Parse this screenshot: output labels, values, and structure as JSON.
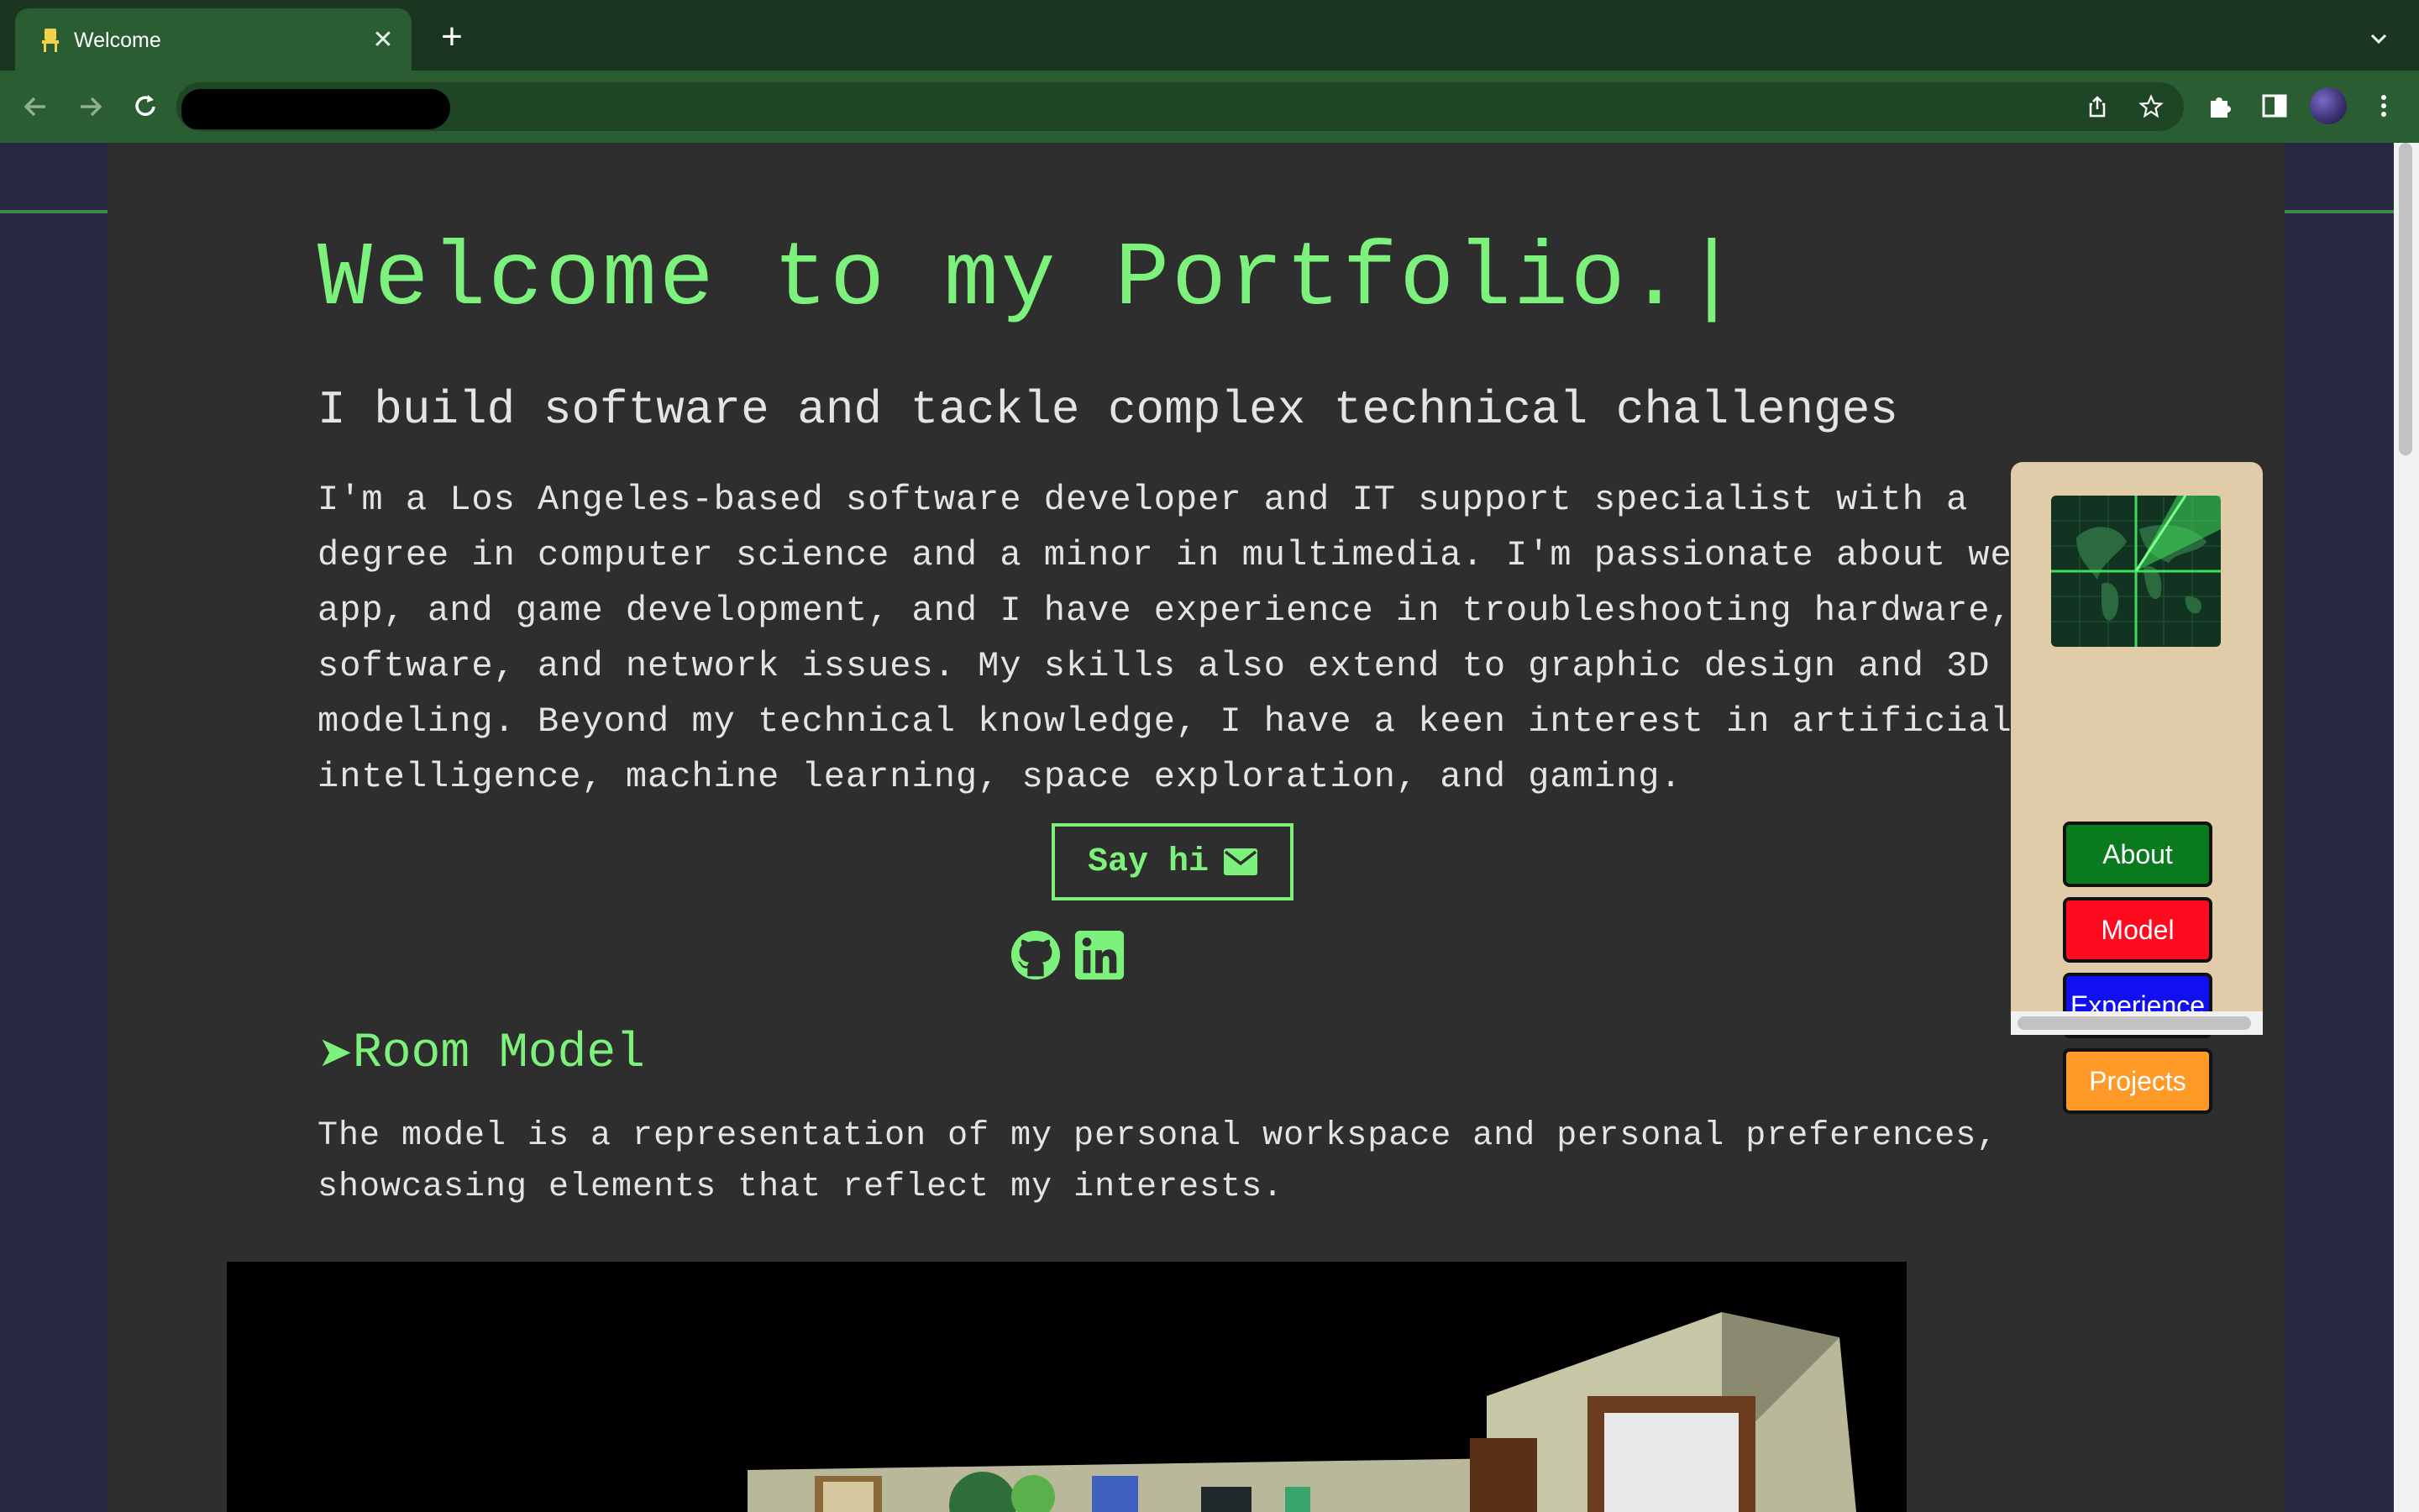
{
  "browser": {
    "tab_title": "Welcome",
    "tab_close": "✕",
    "new_tab": "+"
  },
  "hero": {
    "title": "Welcome to my Portfolio.|",
    "subtitle": "I build software and tackle complex technical challenges",
    "bio": "I'm a Los Angeles-based software developer and IT support specialist with a degree in computer science and a minor in multimedia. I'm passionate about web, app, and game development, and I have experience in troubleshooting hardware, software, and network issues. My skills also extend to graphic design and 3D modeling. Beyond my technical knowledge, I have a keen interest in artificial intelligence, machine learning, space exploration, and gaming.",
    "say_hi": "Say hi"
  },
  "room_model": {
    "arrow": "➤",
    "title": "Room Model",
    "description": "The model is a representation of my personal workspace and personal preferences, showcasing elements that reflect my interests."
  },
  "sidenav": {
    "items": [
      {
        "label": "About",
        "color": "#0a7a1e"
      },
      {
        "label": "Model",
        "color": "#ff0a1e"
      },
      {
        "label": "Experience",
        "color": "#1010f0"
      },
      {
        "label": "Projects",
        "color": "#ff9a28"
      }
    ]
  },
  "colors": {
    "accent": "#7cf17c",
    "page_bg": "#2e2e2e",
    "chrome": "#2a5d31"
  },
  "icons": {
    "envelope": "envelope-icon",
    "github": "github-icon",
    "linkedin": "linkedin-icon"
  }
}
